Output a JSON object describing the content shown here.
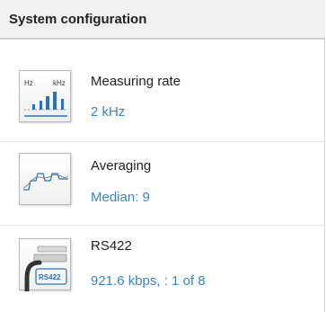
{
  "panel": {
    "title": "System configuration"
  },
  "items": [
    {
      "title": "Measuring rate",
      "value": "2 kHz",
      "icon": "measuring-rate-icon",
      "icon_labels": {
        "left": "Hz",
        "right": "kHz"
      }
    },
    {
      "title": "Averaging",
      "value": "Median: 9",
      "icon": "averaging-icon"
    },
    {
      "title": "RS422",
      "value": "921.6 kbps, : 1 of 8",
      "icon": "rs422-icon",
      "icon_label": "RS422"
    }
  ],
  "colors": {
    "link": "#3a86c0",
    "accent_blue": "#2a73b8",
    "header_bg": "#f1f1f1"
  }
}
